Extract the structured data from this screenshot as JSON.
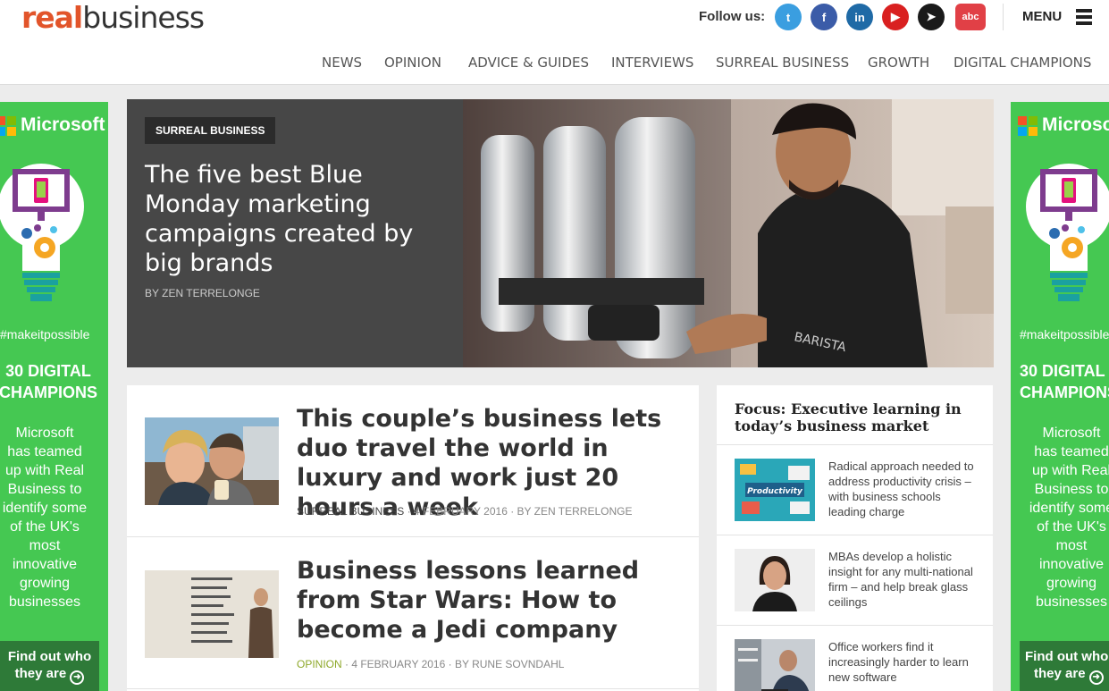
{
  "header": {
    "logo_real": "real",
    "logo_business": "business",
    "follow_label": "Follow us:",
    "social": [
      {
        "name": "twitter-icon",
        "color": "#3a9ee0",
        "glyph": "t"
      },
      {
        "name": "facebook-icon",
        "color": "#3b5ca8",
        "glyph": "f"
      },
      {
        "name": "linkedin-icon",
        "color": "#1f6aa6",
        "glyph": "in"
      },
      {
        "name": "youtube-icon",
        "color": "#d92020",
        "glyph": "▶"
      },
      {
        "name": "telegram-icon",
        "color": "#1a1a1a",
        "glyph": "➤"
      },
      {
        "name": "abc-icon",
        "color": "#e14046",
        "glyph": "abc"
      }
    ],
    "menu_label": "MENU"
  },
  "nav": [
    "NEWS",
    "OPINION",
    "ADVICE & GUIDES",
    "INTERVIEWS",
    "SURREAL BUSINESS",
    "GROWTH",
    "DIGITAL CHAMPIONS"
  ],
  "ad": {
    "brand": "Microsoft",
    "hashtag": "#makeitpossible",
    "champions_line1": "30 DIGITAL",
    "champions_line2": "CHAMPIONS",
    "body_left": [
      "Microsoft",
      "has teamed",
      "up with Real",
      "Business to",
      "identify some",
      "of the UK's",
      "most",
      "innovative",
      "growing",
      "businesses"
    ],
    "cta_line1": "Find out who",
    "cta_line2": "they are"
  },
  "hero": {
    "tag": "SURREAL BUSINESS",
    "title": "The five best Blue Monday marketing campaigns created by big brands",
    "byline": "BY ZEN TERRELONGE"
  },
  "articles": [
    {
      "title": "This couple’s business lets duo travel the world in luxury and work just 20 hours a week",
      "category": "SURREAL BUSINESS",
      "rest": " · 4 FEBRUARY 2016 · BY ZEN TERRELONGE"
    },
    {
      "title": "Business lessons learned from Star Wars: How to become a Jedi company",
      "category": "OPINION",
      "rest": " · 4 FEBRUARY 2016 · BY RUNE SOVNDAHL"
    }
  ],
  "focus": {
    "title": "Focus: Executive learning in today’s business market",
    "items": [
      {
        "text": "Radical approach needed to address productivity crisis – with business schools leading charge",
        "thumb_label": "Productivity"
      },
      {
        "text": "MBAs develop a holistic insight for any multi-national firm – and help break glass ceilings"
      },
      {
        "text": "Office workers find it increasingly harder to learn new software"
      }
    ]
  },
  "colors": {
    "brand_orange": "#e2542a",
    "ad_green": "#45c852",
    "opinion_green": "#8ea82a"
  }
}
